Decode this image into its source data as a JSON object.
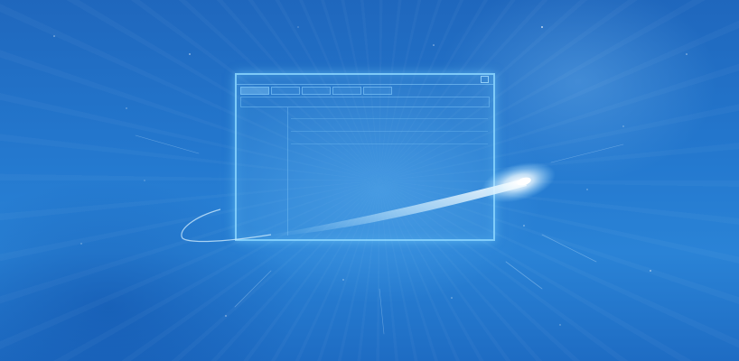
{
  "scene": {
    "background_color": "#2479cf",
    "glow_color": "#8fd6ff"
  },
  "window": {
    "tab_count": 5,
    "close_icon": "close-icon"
  }
}
